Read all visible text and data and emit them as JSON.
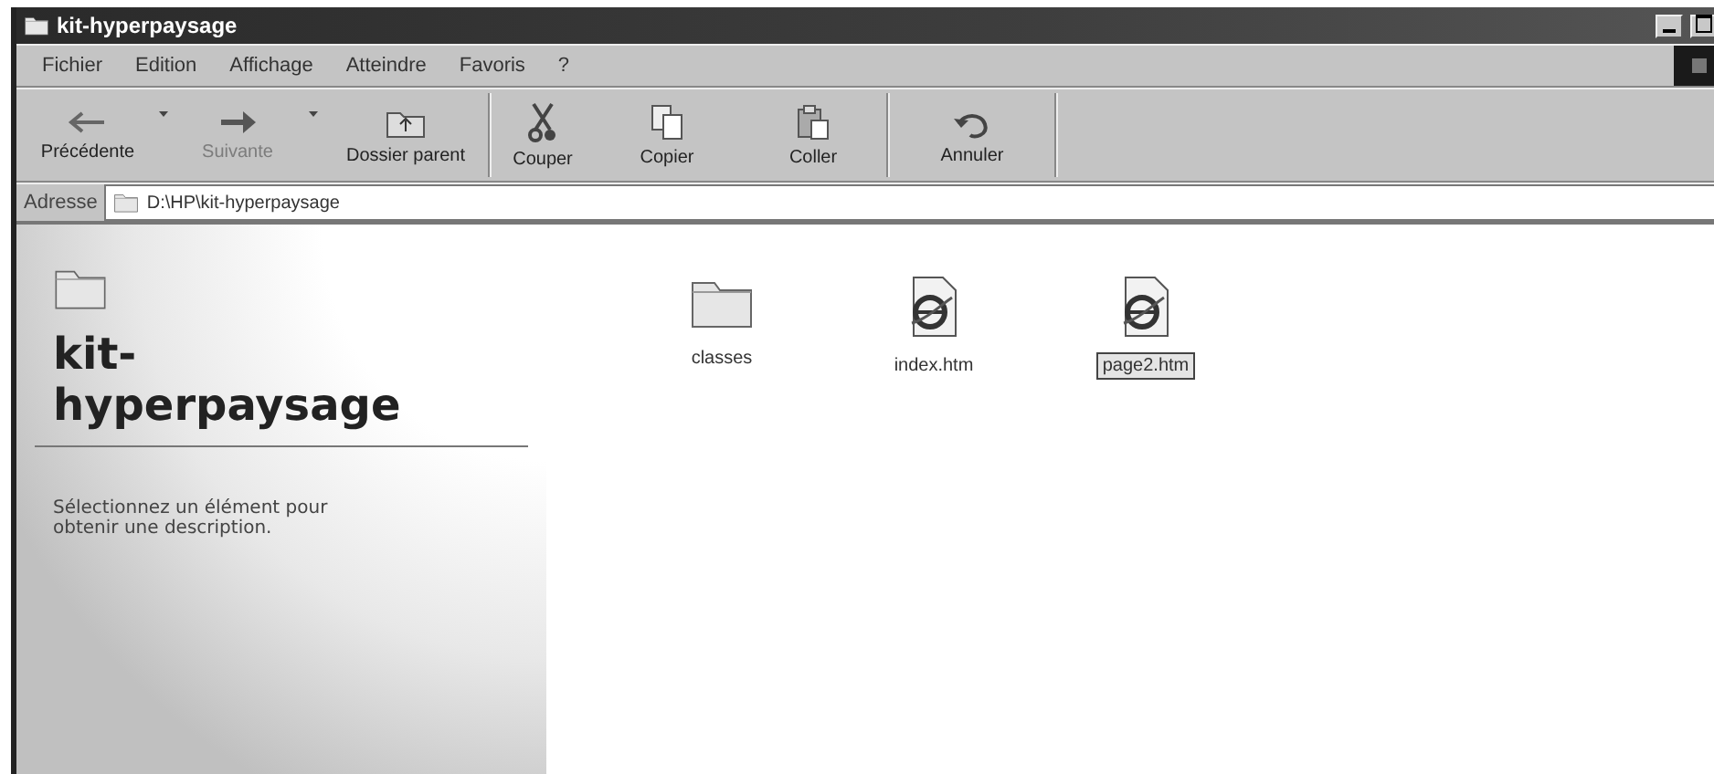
{
  "window": {
    "title": "kit-hyperpaysage"
  },
  "menu": [
    "Fichier",
    "Edition",
    "Affichage",
    "Atteindre",
    "Favoris",
    "?"
  ],
  "toolbar": [
    {
      "label": "Précédente",
      "kind": "back",
      "disabled": false,
      "dropdown": true
    },
    {
      "label": "Suivante",
      "kind": "forward",
      "disabled": true,
      "dropdown": true
    },
    {
      "label": "Dossier parent",
      "kind": "up",
      "disabled": false,
      "dropdown": false
    },
    {
      "label": "Couper",
      "kind": "cut",
      "disabled": false,
      "dropdown": false
    },
    {
      "label": "Copier",
      "kind": "copy",
      "disabled": false,
      "dropdown": false
    },
    {
      "label": "Coller",
      "kind": "paste",
      "disabled": false,
      "dropdown": false
    },
    {
      "label": "Annuler",
      "kind": "undo",
      "disabled": false,
      "dropdown": false
    }
  ],
  "address": {
    "label": "Adresse",
    "value": "D:\\HP\\kit-hyperpaysage"
  },
  "info_panel": {
    "title": "kit-hyperpaysage",
    "description": "Sélectionnez un élément pour obtenir une description."
  },
  "files": [
    {
      "name": "classes",
      "kind": "folder",
      "selected": false
    },
    {
      "name": "index.htm",
      "kind": "html",
      "selected": false
    },
    {
      "name": "page2.htm",
      "kind": "html",
      "selected": true
    }
  ]
}
